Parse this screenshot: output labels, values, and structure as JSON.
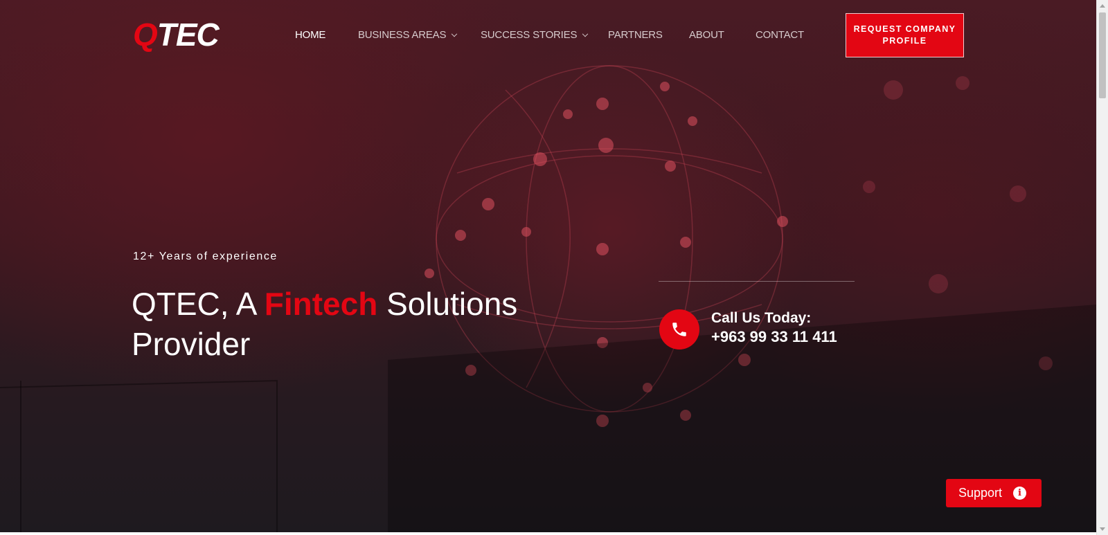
{
  "brand": {
    "logo_prefix": "Q",
    "logo_rest": "TEC"
  },
  "nav": {
    "items": [
      {
        "label": "HOME",
        "active": true,
        "dropdown": false
      },
      {
        "label": "BUSINESS AREAS",
        "active": false,
        "dropdown": true
      },
      {
        "label": "SUCCESS STORIES",
        "active": false,
        "dropdown": true
      },
      {
        "label": "PARTNERS",
        "active": false,
        "dropdown": false
      },
      {
        "label": "ABOUT",
        "active": false,
        "dropdown": false
      },
      {
        "label": "CONTACT",
        "active": false,
        "dropdown": false
      }
    ],
    "cta_label": "REQUEST COMPANY PROFILE"
  },
  "hero": {
    "eyebrow": "12+ Years of experience",
    "headline_before": "QTEC, A ",
    "headline_accent": "Fintech",
    "headline_after": " Solutions Provider"
  },
  "contact": {
    "call_title": "Call Us Today:",
    "phone": "+963 99 33 11 411",
    "icon": "phone-icon"
  },
  "support": {
    "label": "Support",
    "icon_glyph": "i",
    "icon": "info-icon"
  },
  "colors": {
    "accent": "#e30613",
    "hero_dark": "#261a20",
    "hero_red": "#4a1b24"
  }
}
